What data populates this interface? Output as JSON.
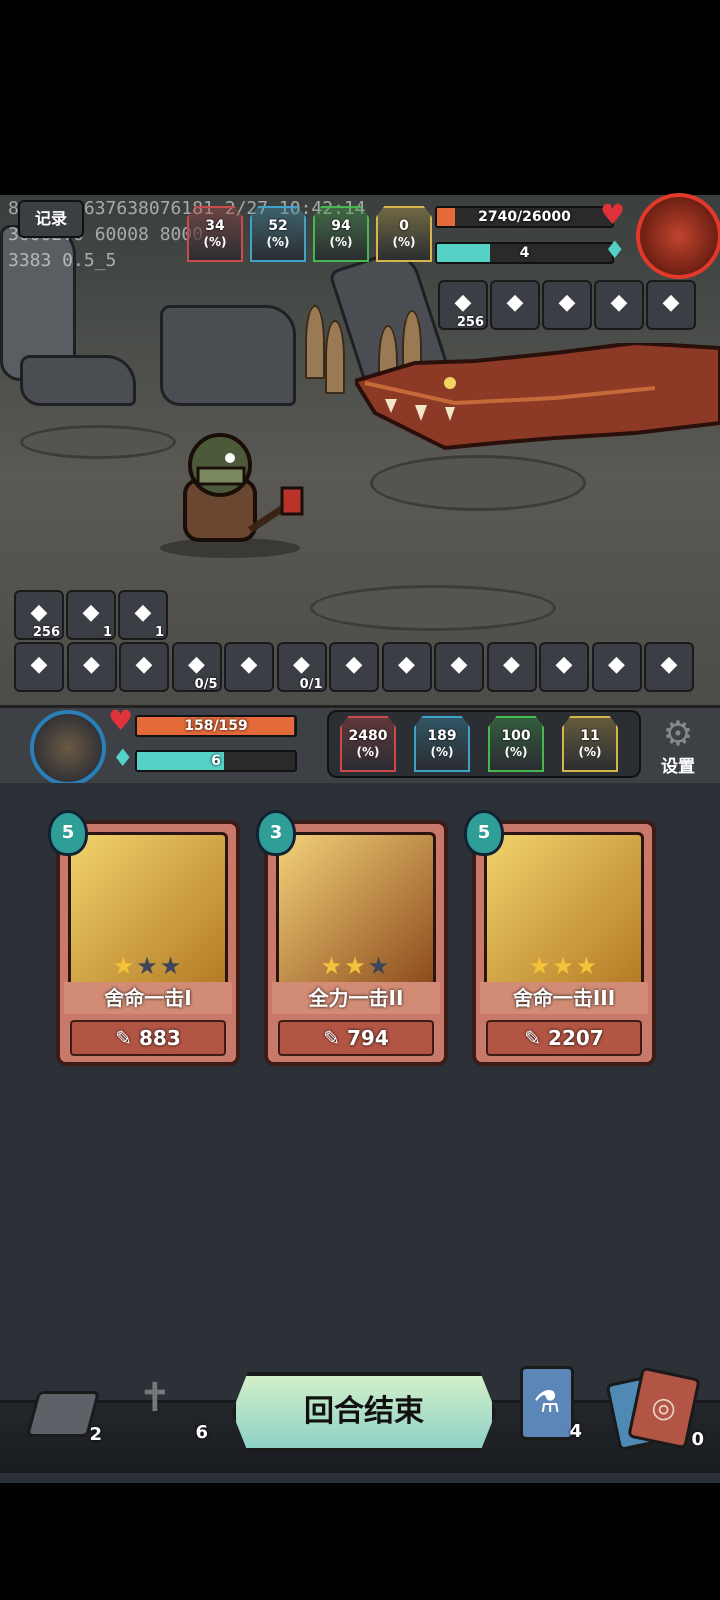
{
  "debug": {
    "line1": "874554863763807618​1 2/27 10:42:14",
    "line2": "30002:0 60008 8000",
    "line3": "3383 0.5_5"
  },
  "record_button": "记录",
  "enemy": {
    "hp": "2740/26000",
    "hp_fraction": 0.105,
    "energy": "4",
    "energy_fraction": 0.3,
    "stats": [
      {
        "value": "34",
        "pct": "(%)",
        "color": "#c94b4b"
      },
      {
        "value": "52",
        "pct": "(%)",
        "color": "#3fa2c8"
      },
      {
        "value": "94",
        "pct": "(%)",
        "color": "#45b84f"
      },
      {
        "value": "0",
        "pct": "(%)",
        "color": "#d6b64a"
      }
    ],
    "buffs": [
      {
        "icon": "voodoo-doll-icon",
        "count": "256"
      },
      {
        "icon": "pink-crystal-icon",
        "count": ""
      },
      {
        "icon": "spike-trap-icon",
        "count": ""
      },
      {
        "icon": "hourglass-icon",
        "count": ""
      },
      {
        "icon": "fire-apple-icon",
        "count": ""
      }
    ]
  },
  "player_buffs": [
    {
      "icon": "voodoo-doll-icon",
      "count": "256"
    },
    {
      "icon": "flame-drop-icon",
      "count": "1"
    },
    {
      "icon": "sword-icon",
      "count": "1"
    }
  ],
  "relics": [
    {
      "icon": "helmet-icon",
      "count": ""
    },
    {
      "icon": "fire-apple-icon",
      "count": ""
    },
    {
      "icon": "shield-icon",
      "count": ""
    },
    {
      "icon": "ring-icon",
      "count": "0/5"
    },
    {
      "icon": "meat-icon",
      "count": ""
    },
    {
      "icon": "blade-icon",
      "count": "0/1"
    },
    {
      "icon": "teddy-bear-icon",
      "count": ""
    },
    {
      "icon": "owl-icon",
      "count": ""
    },
    {
      "icon": "iron-helm-icon",
      "count": ""
    },
    {
      "icon": "treasure-chest-icon",
      "count": ""
    },
    {
      "icon": "bear-trap-icon",
      "count": ""
    },
    {
      "icon": "dark-gem-icon",
      "count": ""
    },
    {
      "icon": "altar-icon",
      "count": ""
    }
  ],
  "player": {
    "hp": "158/159",
    "hp_fraction": 0.994,
    "energy": "6",
    "energy_fraction": 0.55,
    "stats": [
      {
        "value": "2480",
        "pct": "(%)",
        "color": "#c94b4b"
      },
      {
        "value": "189",
        "pct": "(%)",
        "color": "#3fa2c8"
      },
      {
        "value": "100",
        "pct": "(%)",
        "color": "#45b84f"
      },
      {
        "value": "11",
        "pct": "(%)",
        "color": "#d6b64a"
      }
    ],
    "settings_label": "设置"
  },
  "cards": [
    {
      "cost": "5",
      "name": "舍命一击I",
      "damage": "883",
      "stars": 1
    },
    {
      "cost": "3",
      "name": "全力一击II",
      "damage": "794",
      "stars": 2
    },
    {
      "cost": "5",
      "name": "舍命一击III",
      "damage": "2207",
      "stars": 3
    }
  ],
  "bottom": {
    "draw_pile": "2",
    "grave_pile": "6",
    "end_turn": "回合结束",
    "potion_count": "4",
    "discard_pile": "0"
  }
}
